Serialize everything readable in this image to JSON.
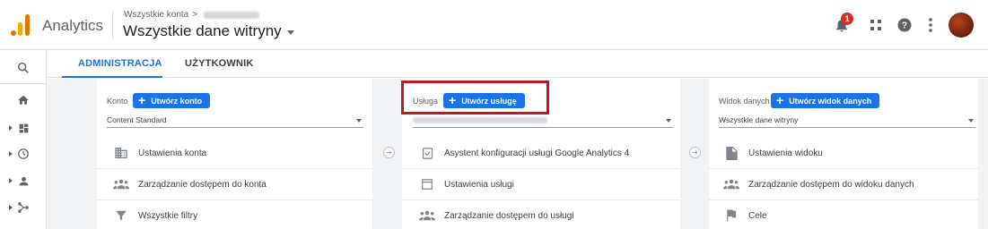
{
  "header": {
    "app_name": "Analytics",
    "breadcrumb_prefix": "Wszystkie konta",
    "breadcrumb_sep": ">",
    "view_name": "Wszystkie dane witryny",
    "notification_count": "1"
  },
  "tabs": [
    {
      "label": "ADMINISTRACJA",
      "active": true
    },
    {
      "label": "UŻYTKOWNIK",
      "active": false
    }
  ],
  "account": {
    "label": "Konto",
    "create_label": "Utwórz konto",
    "selected": "Content Standard",
    "items": [
      {
        "icon": "building-icon",
        "label": "Ustawienia konta"
      },
      {
        "icon": "people-icon",
        "label": "Zarządzanie dostępem do konta"
      },
      {
        "icon": "filter-icon",
        "label": "Wszystkie filtry"
      }
    ]
  },
  "property": {
    "label": "Usługa",
    "create_label": "Utwórz usługę",
    "items": [
      {
        "icon": "checklist-icon",
        "label": "Asystent konfiguracji usługi Google Analytics 4"
      },
      {
        "icon": "window-icon",
        "label": "Ustawienia usługi"
      },
      {
        "icon": "people-icon",
        "label": "Zarządzanie dostępem do usługi"
      }
    ]
  },
  "view": {
    "label": "Widok danych",
    "create_label": "Utwórz widok danych",
    "selected": "Wszystkie dane witryny",
    "items": [
      {
        "icon": "document-icon",
        "label": "Ustawienia widoku"
      },
      {
        "icon": "people-icon",
        "label": "Zarządzanie dostępem do widoku danych"
      },
      {
        "icon": "flag-icon",
        "label": "Cele"
      }
    ]
  },
  "colors": {
    "accent": "#1a73e8",
    "highlight": "#c5161d",
    "logo_orange": "#e37400",
    "logo_yellow": "#f9ab00"
  }
}
